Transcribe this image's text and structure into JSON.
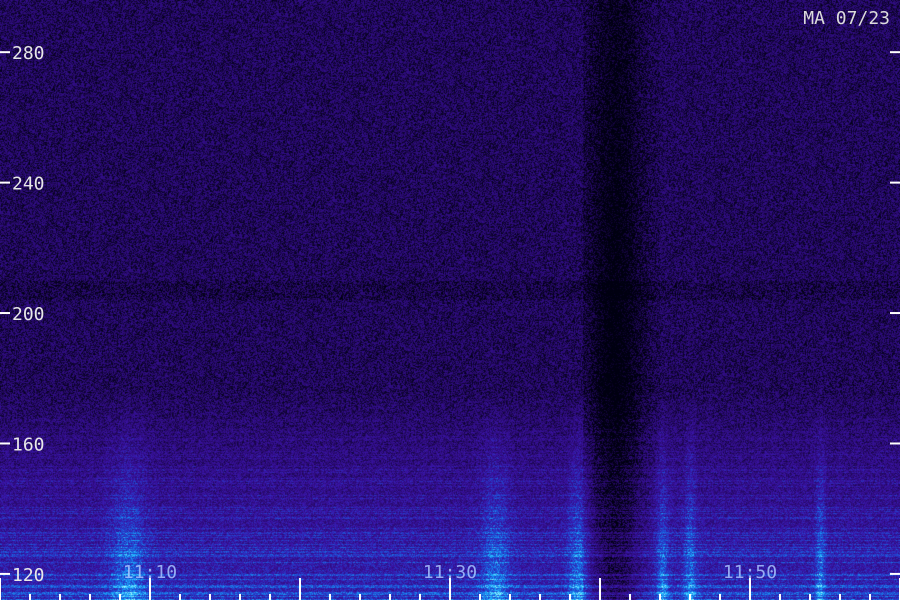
{
  "chart_data": {
    "type": "heatmap",
    "title": "MA 07/23",
    "xlabel": "",
    "ylabel": "",
    "y_ticks": [
      280,
      240,
      200,
      160,
      120
    ],
    "ylim": [
      112,
      296
    ],
    "x_ticks": [
      "11:10",
      "11:30",
      "11:50"
    ],
    "x_tick_minutes": [
      70,
      90,
      110
    ],
    "xlim_minutes": [
      60,
      120
    ],
    "grid": false,
    "colormap": [
      "#000010",
      "#2a0a70",
      "#3a14a8",
      "#1d4fd6",
      "#19b5ff",
      "#a9ffff"
    ]
  }
}
